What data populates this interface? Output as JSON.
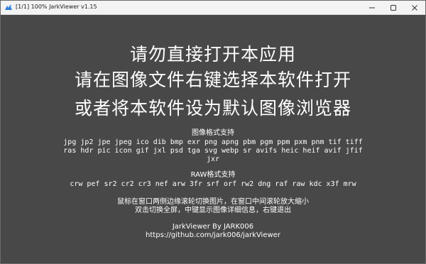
{
  "window": {
    "title": "[1/1] 100% JarkViewer v1.15",
    "background_color": "#484848",
    "title_icon": "app-logo-icon",
    "controls": {
      "minimize_icon": "minimize-icon",
      "maximize_icon": "maximize-icon",
      "close_icon": "close-icon"
    }
  },
  "main": {
    "headline_lines": [
      "请勿直接打开本应用",
      "请在图像文件右键选择本软件打开",
      "或者将本软件设为默认图像浏览器"
    ],
    "image_formats_title": "图像格式支持",
    "image_formats": "jpg jp2 jpe jpeg ico dib bmp exr png apng pbm pgm ppm pxm pnm tif tiff ras hdr pic icon gif jxl psd tga svg webp sr avifs heic heif avif jfif jxr",
    "raw_formats_title": "RAW格式支持",
    "raw_formats": "crw pef sr2 cr2 cr3 nef arw 3fr srf orf rw2 dng raf raw kdc x3f mrw",
    "tips": [
      "鼠标在窗口两侧边缘滚轮切换图片，在窗口中间滚轮放大缩小",
      "双击切换全屏，中键显示图像详细信息，右键退出"
    ],
    "credit": "JarkViewer By JARK006",
    "repo_url": "https://github.com/jark006/jarkViewer"
  }
}
